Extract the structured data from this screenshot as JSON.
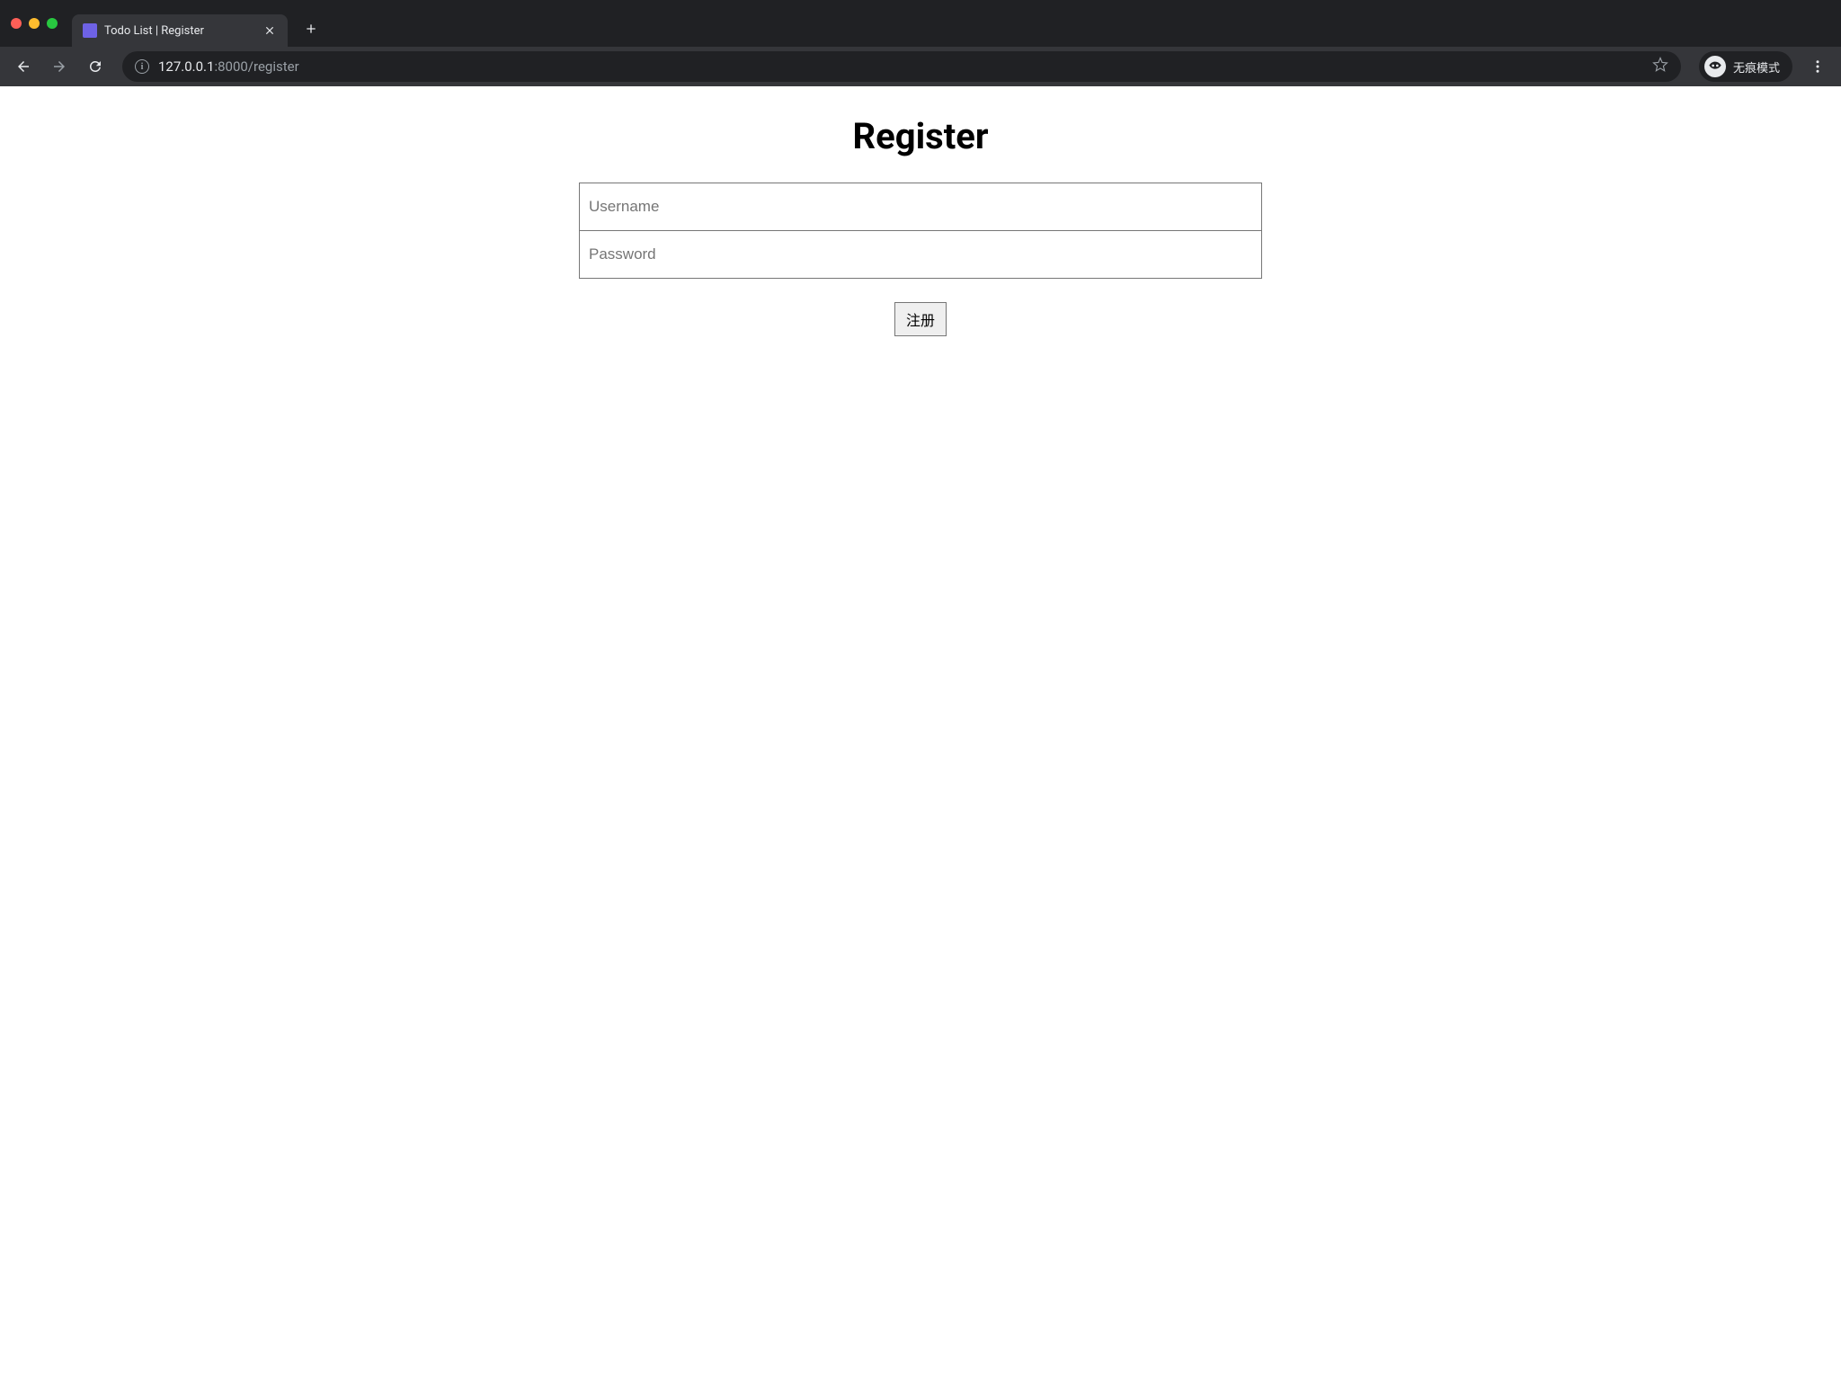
{
  "browser": {
    "tab_title": "Todo List | Register",
    "url_host": "127.0.0.1",
    "url_path": ":8000/register",
    "incognito_label": "无痕模式"
  },
  "page": {
    "heading": "Register",
    "username_placeholder": "Username",
    "password_placeholder": "Password",
    "submit_label": "注册"
  }
}
